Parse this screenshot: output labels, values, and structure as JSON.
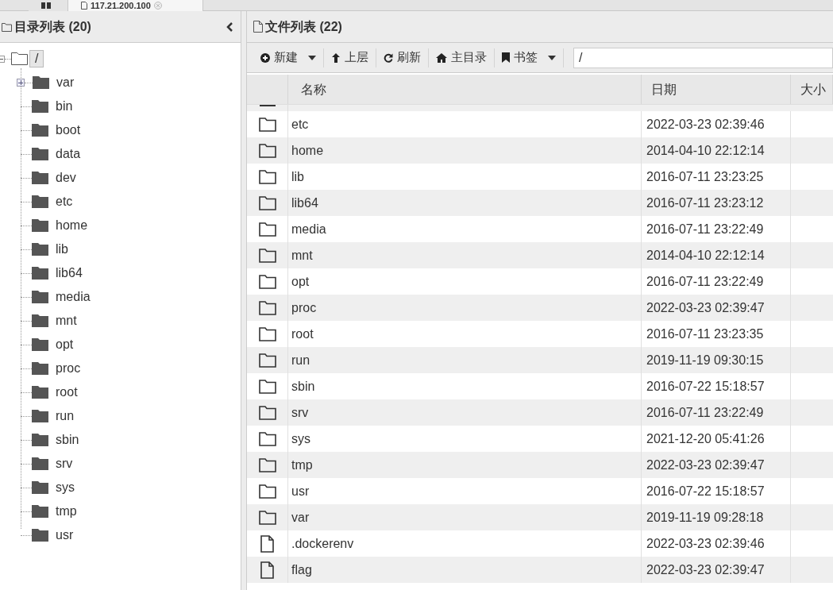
{
  "tabs": [
    {
      "kind": "icon",
      "selected": false
    },
    {
      "kind": "text",
      "label": "117.21.200.100",
      "selected": true
    }
  ],
  "dir_panel": {
    "title": "目录列表 (20)",
    "tree": [
      {
        "label": "/",
        "selected": true,
        "expanded": true,
        "children": [
          {
            "label": "var",
            "expandable": true
          },
          {
            "label": "bin"
          },
          {
            "label": "boot"
          },
          {
            "label": "data"
          },
          {
            "label": "dev"
          },
          {
            "label": "etc"
          },
          {
            "label": "home"
          },
          {
            "label": "lib"
          },
          {
            "label": "lib64"
          },
          {
            "label": "media"
          },
          {
            "label": "mnt"
          },
          {
            "label": "opt"
          },
          {
            "label": "proc"
          },
          {
            "label": "root"
          },
          {
            "label": "run"
          },
          {
            "label": "sbin"
          },
          {
            "label": "srv"
          },
          {
            "label": "sys"
          },
          {
            "label": "tmp"
          },
          {
            "label": "usr"
          }
        ]
      }
    ]
  },
  "file_panel": {
    "title": "文件列表 (22)",
    "toolbar": [
      {
        "kind": "plus",
        "label": "新建",
        "dropdown": true
      },
      {
        "kind": "up",
        "label": "上层",
        "dropdown": false
      },
      {
        "kind": "refresh",
        "label": "刷新",
        "dropdown": false
      },
      {
        "kind": "home",
        "label": "主目录",
        "dropdown": false
      },
      {
        "kind": "bookmark",
        "label": "书签",
        "dropdown": true
      }
    ],
    "path": "/",
    "columns": [
      "名称",
      "日期",
      "大小"
    ],
    "rows": [
      {
        "kind": "folder",
        "name": "etc",
        "date": "2022-03-23 02:39:46"
      },
      {
        "kind": "folder",
        "name": "home",
        "date": "2014-04-10 22:12:14"
      },
      {
        "kind": "folder",
        "name": "lib",
        "date": "2016-07-11 23:23:25"
      },
      {
        "kind": "folder",
        "name": "lib64",
        "date": "2016-07-11 23:23:12"
      },
      {
        "kind": "folder",
        "name": "media",
        "date": "2016-07-11 23:22:49"
      },
      {
        "kind": "folder",
        "name": "mnt",
        "date": "2014-04-10 22:12:14"
      },
      {
        "kind": "folder",
        "name": "opt",
        "date": "2016-07-11 23:22:49"
      },
      {
        "kind": "folder",
        "name": "proc",
        "date": "2022-03-23 02:39:47"
      },
      {
        "kind": "folder",
        "name": "root",
        "date": "2016-07-11 23:23:35"
      },
      {
        "kind": "folder",
        "name": "run",
        "date": "2019-11-19 09:30:15"
      },
      {
        "kind": "folder",
        "name": "sbin",
        "date": "2016-07-22 15:18:57"
      },
      {
        "kind": "folder",
        "name": "srv",
        "date": "2016-07-11 23:22:49"
      },
      {
        "kind": "folder",
        "name": "sys",
        "date": "2021-12-20 05:41:26"
      },
      {
        "kind": "folder",
        "name": "tmp",
        "date": "2022-03-23 02:39:47"
      },
      {
        "kind": "folder",
        "name": "usr",
        "date": "2016-07-22 15:18:57"
      },
      {
        "kind": "folder",
        "name": "var",
        "date": "2019-11-19 09:28:18"
      },
      {
        "kind": "file",
        "name": ".dockerenv",
        "date": "2022-03-23 02:39:46"
      },
      {
        "kind": "file",
        "name": "flag",
        "date": "2022-03-23 02:39:47"
      }
    ]
  }
}
